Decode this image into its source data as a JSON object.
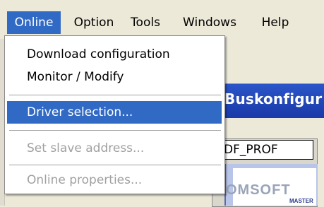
{
  "menubar": {
    "items": [
      {
        "label": "Online",
        "active": true
      },
      {
        "label": "Option"
      },
      {
        "label": "Tools"
      },
      {
        "label": "Windows"
      },
      {
        "label": "Help"
      }
    ]
  },
  "dropdown": {
    "items": [
      {
        "label": "Download configuration",
        "state": "normal"
      },
      {
        "label": "Monitor / Modify",
        "state": "normal"
      },
      {
        "label": "Driver selection...",
        "state": "highlighted"
      },
      {
        "label": "Set slave address...",
        "state": "disabled"
      },
      {
        "label": "Online properties...",
        "state": "disabled"
      }
    ]
  },
  "background": {
    "title_fragment": "Buskonfigur",
    "device_label": ") DF_PROF",
    "brand": "OMSOFT",
    "brand_sub": "MASTER"
  },
  "colors": {
    "highlight": "#316ac5",
    "menubar_bg": "#ece9d8",
    "disabled_text": "#a0a0a0"
  }
}
